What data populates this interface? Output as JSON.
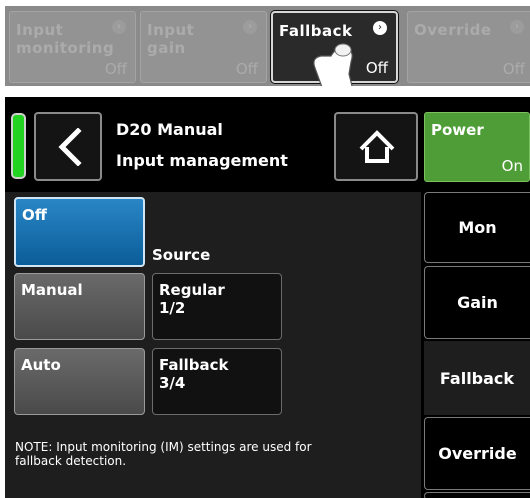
{
  "strip": {
    "buttons": [
      {
        "label": "Input\nmonitoring",
        "value": "Off",
        "state": "disabled"
      },
      {
        "label": "Input\ngain",
        "value": "Off",
        "state": "disabled"
      },
      {
        "label": "Fallback",
        "value": "Off",
        "state": "active"
      },
      {
        "label": "Override",
        "value": "Off",
        "state": "disabled"
      }
    ]
  },
  "header": {
    "device": "D20 Manual",
    "page": "Input management",
    "power_label": "Power",
    "power_value": "On",
    "power_color": "#4f9d36",
    "led_color": "#22d322"
  },
  "main": {
    "off_label": "Off",
    "source_label": "Source",
    "manual_label": "Manual",
    "auto_label": "Auto",
    "regular_label": "Regular\n1/2",
    "fallback_label": "Fallback\n3/4",
    "note": "NOTE: Input monitoring (IM) settings are used for fallback detection.",
    "selected_color": "#0a5d98"
  },
  "tabs": {
    "mon": "Mon",
    "gain": "Gain",
    "fallback": "Fallback",
    "override": "Override"
  }
}
